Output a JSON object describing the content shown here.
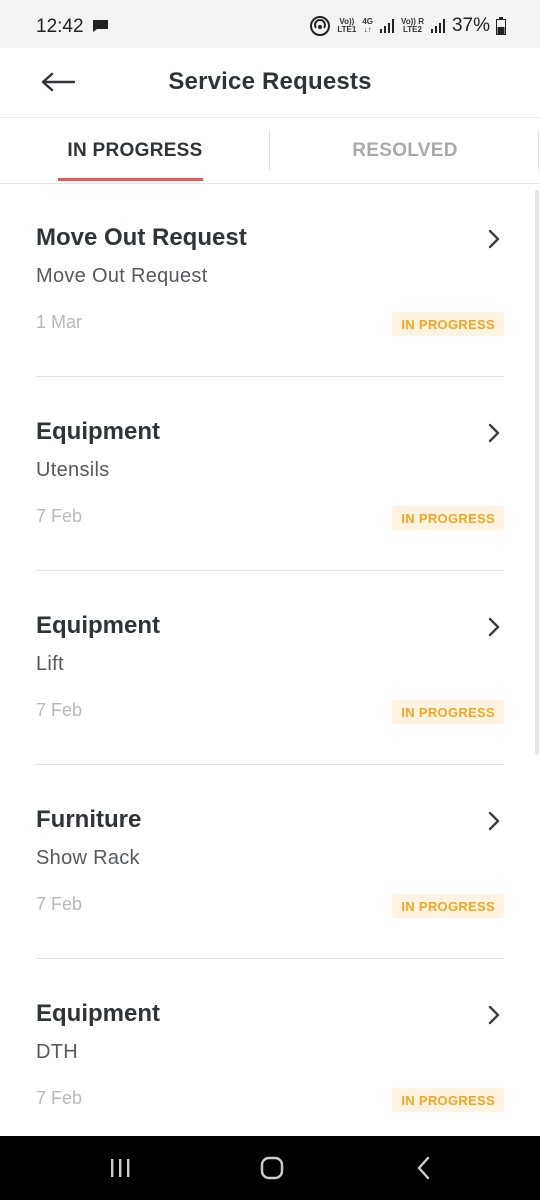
{
  "status_bar": {
    "time": "12:42",
    "network": {
      "sim1_top": "Vo))",
      "sim1_bottom": "LTE1",
      "tech": "4G",
      "sim2_top": "Vo))",
      "sim2_bottom": "LTE2",
      "roaming": "R"
    },
    "battery": "37%",
    "icons": [
      "message-icon",
      "hotspot-icon",
      "signal-icon",
      "battery-icon"
    ]
  },
  "header": {
    "title": "Service Requests",
    "back_icon": "arrow-left-icon"
  },
  "tabs": [
    {
      "label": "IN PROGRESS",
      "active": true
    },
    {
      "label": "RESOLVED",
      "active": false
    }
  ],
  "requests": [
    {
      "title": "Move Out Request",
      "subtitle": "Move Out Request",
      "date": "1 Mar",
      "status": "IN PROGRESS"
    },
    {
      "title": "Equipment",
      "subtitle": "Utensils",
      "date": "7 Feb",
      "status": "IN PROGRESS"
    },
    {
      "title": "Equipment",
      "subtitle": "Lift",
      "date": "7 Feb",
      "status": "IN PROGRESS"
    },
    {
      "title": "Furniture",
      "subtitle": "Show Rack",
      "date": "7 Feb",
      "status": "IN PROGRESS"
    },
    {
      "title": "Equipment",
      "subtitle": "DTH",
      "date": "7 Feb",
      "status": "IN PROGRESS"
    }
  ],
  "colors": {
    "accent": "#e9565c",
    "status_text": "#f2a723",
    "status_bg": "#fdf3e0",
    "title_text": "#2f3438"
  },
  "nav": {
    "icons": [
      "recent-apps-icon",
      "home-icon",
      "back-icon"
    ]
  }
}
